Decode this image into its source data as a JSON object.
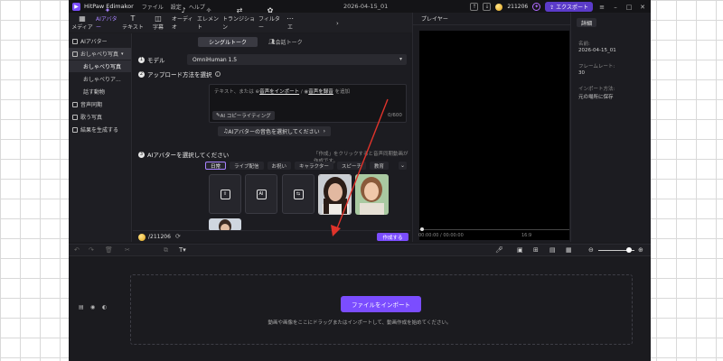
{
  "titlebar": {
    "app_name": "HitPaw Edimakor",
    "menus": [
      "ファイル",
      "設定",
      "ヘルプ"
    ],
    "project_name": "2026-04-15_01",
    "credits": "211206",
    "export_label": "エクスポート"
  },
  "toolbar": {
    "tools": [
      {
        "icon": "▦",
        "label": "メディア"
      },
      {
        "icon": "✦",
        "label": "AIアバター"
      },
      {
        "icon": "T",
        "label": "テキスト"
      },
      {
        "icon": "◫",
        "label": "字幕"
      },
      {
        "icon": "♪",
        "label": "オーディオ"
      },
      {
        "icon": "✧",
        "label": "エレメント"
      },
      {
        "icon": "⇄",
        "label": "トランジション"
      },
      {
        "icon": "✿",
        "label": "フィルター"
      },
      {
        "icon": "⋯",
        "label": "エ"
      }
    ]
  },
  "sidebar": {
    "items": [
      {
        "label": "AIアバター"
      },
      {
        "label": "おしゃべり写真"
      },
      {
        "label": "おしゃべり写真"
      },
      {
        "label": "おしゃべりア..."
      },
      {
        "label": "話す動物"
      },
      {
        "label": "音声同期"
      },
      {
        "label": "歌う写真"
      },
      {
        "label": "結果を生成する"
      }
    ]
  },
  "panel": {
    "tab_single": "シングルトーク",
    "tab_conversation": "会話トーク",
    "step1_label": "モデル",
    "model_value": "OmniHuman 1.5",
    "step2_label": "アップロード方法を選択",
    "text_placeholder_prefix": "テキスト、または",
    "import_audio_link": "音声をインポート",
    "record_audio_link": "音声を録音",
    "text_placeholder_suffix": "を追加",
    "ai_copywriting": "AI コピーライティング",
    "char_counter": "0/600",
    "voice_select": "AIアバターの音色を選択してください",
    "step3_label": "AIアバターを選択してください",
    "step3_hint": "「作成」をクリックすると音声同期動画が作成です。",
    "categories": [
      "日常",
      "ライブ配信",
      "お祝い",
      "キャラクター",
      "スピーチ",
      "教育"
    ],
    "credits": "211206",
    "create_label": "作成する"
  },
  "player": {
    "tab_label": "プレイヤー",
    "timecode": "00:00:00 / 00:00:00",
    "ratio": "16:9"
  },
  "details": {
    "tab_label": "詳細",
    "name_label": "名前:",
    "name_value": "2026-04-15_01",
    "fps_label": "フレームレート:",
    "fps_value": "30",
    "import_label": "インポート方法:",
    "import_value": "元の場所に保存"
  },
  "timeline": {
    "import_button": "ファイルをインポート",
    "drop_hint": "動画や画像をここにドラッグまたはインポートして、動画作成を始めてください。"
  },
  "colors": {
    "accent": "#7b4dff",
    "annotation_arrow": "#e0332b"
  }
}
